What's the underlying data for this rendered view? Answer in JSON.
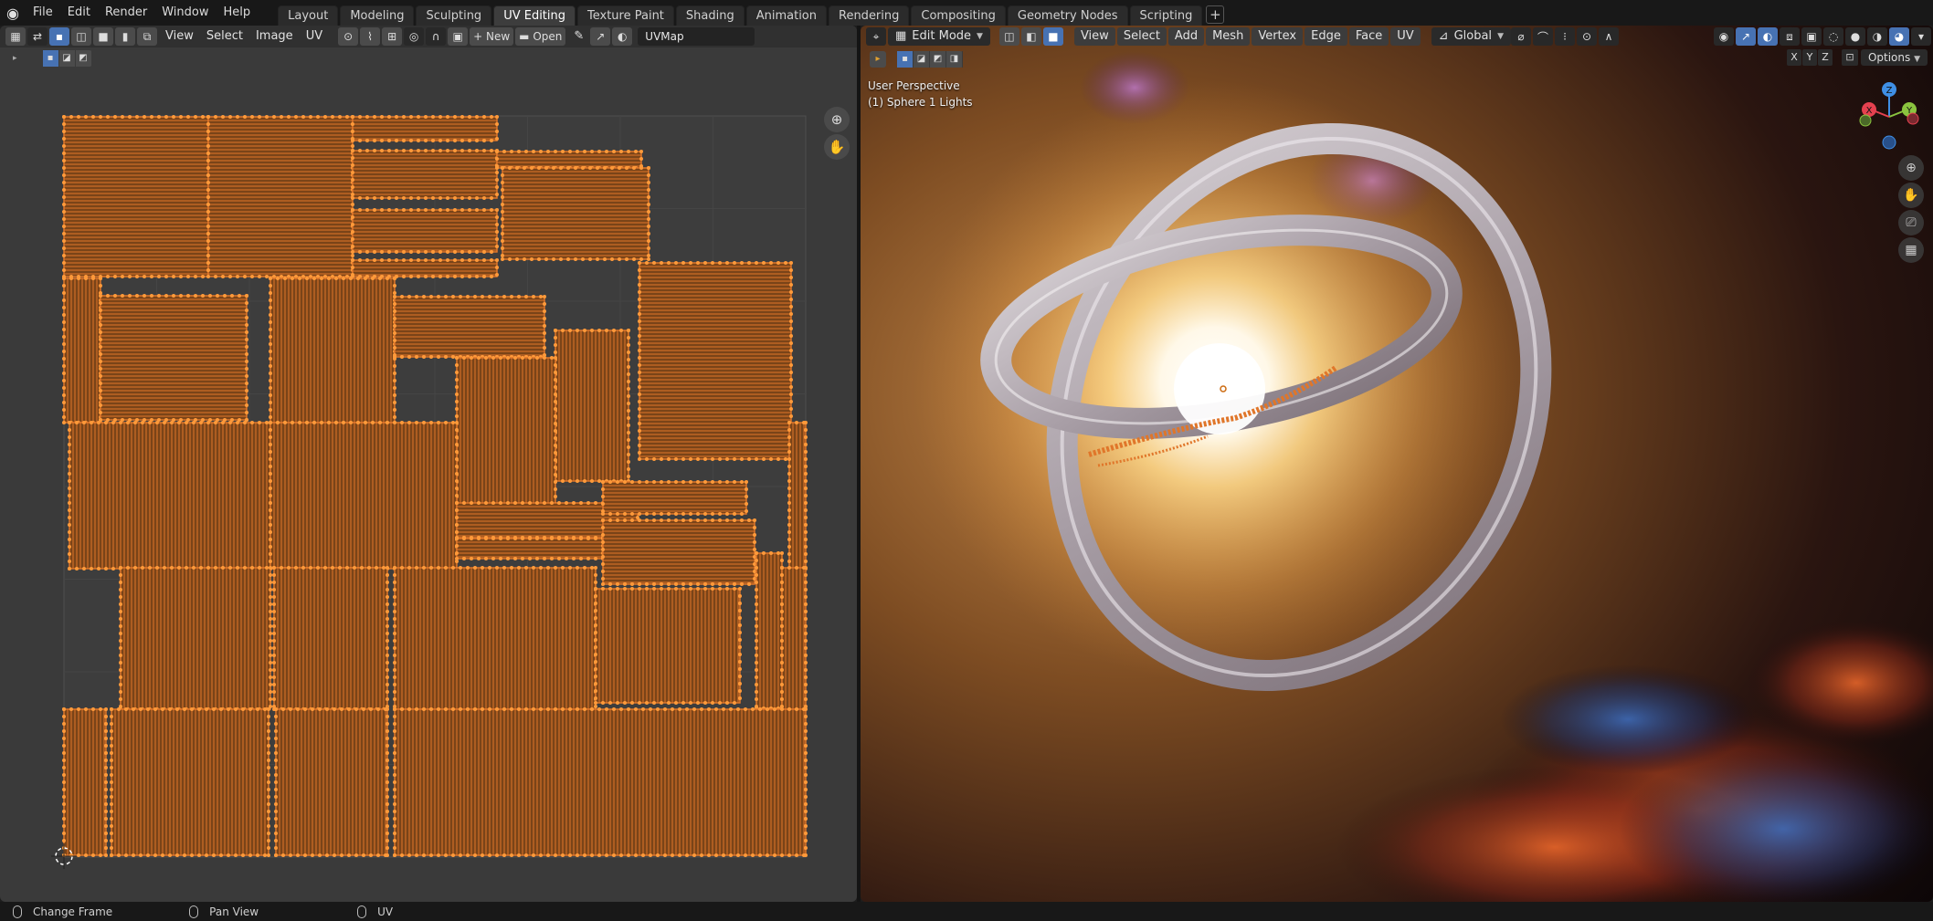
{
  "app": {
    "menu": [
      "File",
      "Edit",
      "Render",
      "Window",
      "Help"
    ],
    "workspace_tabs": [
      "Layout",
      "Modeling",
      "Sculpting",
      "UV Editing",
      "Texture Paint",
      "Shading",
      "Animation",
      "Rendering",
      "Compositing",
      "Geometry Nodes",
      "Scripting"
    ],
    "active_tab": "UV Editing",
    "add_tab": "+"
  },
  "uv_editor": {
    "menus": [
      "View",
      "Select",
      "Image",
      "UV"
    ],
    "new_label": "New",
    "open_label": "Open",
    "uvmap_field": "UVMap"
  },
  "viewport": {
    "mode": "Edit Mode",
    "menus": [
      "View",
      "Select",
      "Add",
      "Mesh",
      "Vertex",
      "Edge",
      "Face",
      "UV"
    ],
    "orientation": "Global",
    "overlay_line1": "User Perspective",
    "overlay_line2": "(1) Sphere 1 Lights",
    "mirror_axes": [
      "X",
      "Y",
      "Z"
    ],
    "options_label": "Options",
    "gizmo_axes": [
      "X",
      "Y",
      "Z"
    ]
  },
  "statusbar": {
    "items": [
      "Change Frame",
      "Pan View",
      "UV"
    ]
  },
  "colors": {
    "accent": "#4772b3",
    "uv_edge": "#e0762a",
    "uv_vertex": "#ff9a3a",
    "axis_x": "#e5414f",
    "axis_y": "#8bc43f",
    "axis_z": "#3f8fe5"
  }
}
